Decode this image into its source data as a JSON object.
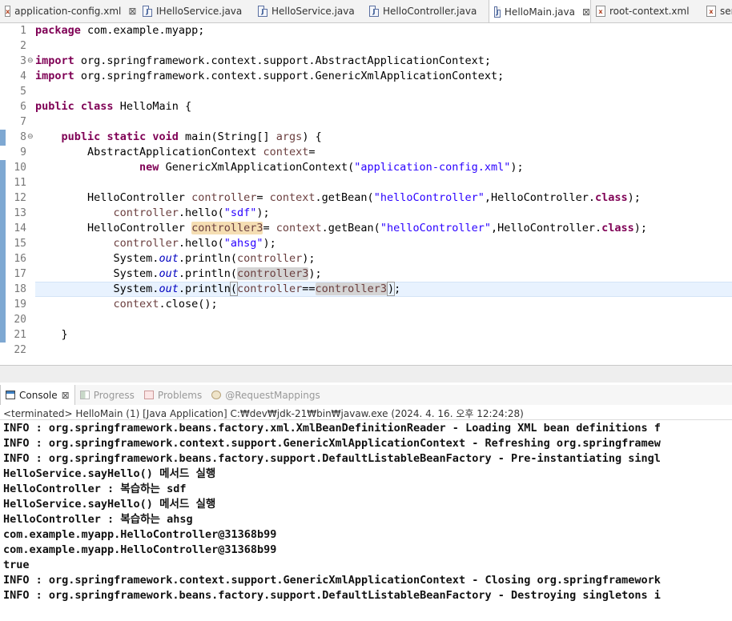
{
  "tabs": [
    {
      "label": "application-config.xml",
      "icon": "xml-file-icon",
      "closable": true,
      "active": false
    },
    {
      "label": "IHelloService.java",
      "icon": "java-file-icon",
      "closable": false,
      "active": false
    },
    {
      "label": "HelloService.java",
      "icon": "java-file-icon",
      "closable": false,
      "active": false
    },
    {
      "label": "HelloController.java",
      "icon": "java-file-icon",
      "closable": false,
      "active": false
    },
    {
      "label": "HelloMain.java",
      "icon": "java-file-icon",
      "closable": true,
      "active": true
    },
    {
      "label": "root-context.xml",
      "icon": "xml-file-icon",
      "closable": false,
      "active": false
    },
    {
      "label": "ser",
      "icon": "xml-file-icon",
      "closable": false,
      "active": false
    }
  ],
  "editor": {
    "line_numbers": [
      "1",
      "2",
      "3",
      "4",
      "5",
      "6",
      "7",
      "8",
      "9",
      "10",
      "11",
      "12",
      "13",
      "14",
      "15",
      "16",
      "17",
      "18",
      "19",
      "20",
      "21",
      "22"
    ],
    "fold_markers": {
      "3": "⊖",
      "8": "⊖"
    },
    "current_line": 18,
    "lines": [
      [
        {
          "t": "package",
          "c": "kw"
        },
        {
          "t": " com.example.myapp;"
        }
      ],
      [],
      [
        {
          "t": "import",
          "c": "kw"
        },
        {
          "t": " org.springframework.context.support.AbstractApplicationContext;"
        }
      ],
      [
        {
          "t": "import",
          "c": "kw"
        },
        {
          "t": " org.springframework.context.support.GenericXmlApplicationContext;"
        }
      ],
      [],
      [
        {
          "t": "public",
          "c": "kw"
        },
        {
          "t": " "
        },
        {
          "t": "class",
          "c": "kw"
        },
        {
          "t": " HelloMain {"
        }
      ],
      [],
      [
        {
          "t": "    "
        },
        {
          "t": "public",
          "c": "kw"
        },
        {
          "t": " "
        },
        {
          "t": "static",
          "c": "kw"
        },
        {
          "t": " "
        },
        {
          "t": "void",
          "c": "kw"
        },
        {
          "t": " main(String[] "
        },
        {
          "t": "args",
          "c": "var"
        },
        {
          "t": ") {"
        }
      ],
      [
        {
          "t": "        AbstractApplicationContext "
        },
        {
          "t": "context",
          "c": "var"
        },
        {
          "t": "="
        }
      ],
      [
        {
          "t": "                "
        },
        {
          "t": "new",
          "c": "kw"
        },
        {
          "t": " GenericXmlApplicationContext("
        },
        {
          "t": "\"application-config.xml\"",
          "c": "str"
        },
        {
          "t": ");"
        }
      ],
      [],
      [
        {
          "t": "        HelloController "
        },
        {
          "t": "controller",
          "c": "var"
        },
        {
          "t": "= "
        },
        {
          "t": "context",
          "c": "var"
        },
        {
          "t": ".getBean("
        },
        {
          "t": "\"helloController\"",
          "c": "str"
        },
        {
          "t": ",HelloController."
        },
        {
          "t": "class",
          "c": "kw"
        },
        {
          "t": ");"
        }
      ],
      [
        {
          "t": "            "
        },
        {
          "t": "controller",
          "c": "var"
        },
        {
          "t": ".hello("
        },
        {
          "t": "\"sdf\"",
          "c": "str"
        },
        {
          "t": ");"
        }
      ],
      [
        {
          "t": "        HelloController "
        },
        {
          "t": "controller3",
          "c": "var occw"
        },
        {
          "t": "= "
        },
        {
          "t": "context",
          "c": "var"
        },
        {
          "t": ".getBean("
        },
        {
          "t": "\"helloController\"",
          "c": "str"
        },
        {
          "t": ",HelloController."
        },
        {
          "t": "class",
          "c": "kw"
        },
        {
          "t": ");"
        }
      ],
      [
        {
          "t": "            "
        },
        {
          "t": "controller",
          "c": "var"
        },
        {
          "t": ".hello("
        },
        {
          "t": "\"ahsg\"",
          "c": "str"
        },
        {
          "t": ");"
        }
      ],
      [
        {
          "t": "            System."
        },
        {
          "t": "out",
          "c": "fld"
        },
        {
          "t": ".println("
        },
        {
          "t": "controller",
          "c": "var"
        },
        {
          "t": ");"
        }
      ],
      [
        {
          "t": "            System."
        },
        {
          "t": "out",
          "c": "fld"
        },
        {
          "t": ".println("
        },
        {
          "t": "controller3",
          "c": "var occ"
        },
        {
          "t": ");"
        }
      ],
      [
        {
          "t": "            System."
        },
        {
          "t": "out",
          "c": "fld"
        },
        {
          "t": ".println"
        },
        {
          "t": "(",
          "c": "bm"
        },
        {
          "t": "controller",
          "c": "var"
        },
        {
          "t": "=="
        },
        {
          "t": "controller3",
          "c": "var occ"
        },
        {
          "t": "",
          "c": "caret"
        },
        {
          "t": ")",
          "c": "bm"
        },
        {
          "t": ";"
        }
      ],
      [
        {
          "t": "            "
        },
        {
          "t": "context",
          "c": "var"
        },
        {
          "t": ".close();"
        }
      ],
      [],
      [
        {
          "t": "    }"
        }
      ],
      []
    ]
  },
  "views": [
    {
      "label": "Console",
      "icon": "console-icon",
      "active": true,
      "close": "⊠"
    },
    {
      "label": "Progress",
      "icon": "progress-icon",
      "active": false
    },
    {
      "label": "Problems",
      "icon": "problems-icon",
      "active": false
    },
    {
      "label": "@RequestMappings",
      "icon": "request-mappings-icon",
      "active": false
    }
  ],
  "console": {
    "status": "<terminated> HelloMain (1) [Java Application] C:₩dev₩jdk-21₩bin₩javaw.exe (2024. 4. 16. 오후 12:24:28)",
    "output": [
      "INFO : org.springframework.beans.factory.xml.XmlBeanDefinitionReader - Loading XML bean definitions f",
      "INFO : org.springframework.context.support.GenericXmlApplicationContext - Refreshing org.springframew",
      "INFO : org.springframework.beans.factory.support.DefaultListableBeanFactory - Pre-instantiating singl",
      "HelloService.sayHello() 메서드 실행",
      "HelloController : 복습하는 sdf",
      "HelloService.sayHello() 메서드 실행",
      "HelloController : 복습하는 ahsg",
      "com.example.myapp.HelloController@31368b99",
      "com.example.myapp.HelloController@31368b99",
      "true",
      "INFO : org.springframework.context.support.GenericXmlApplicationContext - Closing org.springframework",
      "INFO : org.springframework.beans.factory.support.DefaultListableBeanFactory - Destroying singletons i"
    ]
  }
}
